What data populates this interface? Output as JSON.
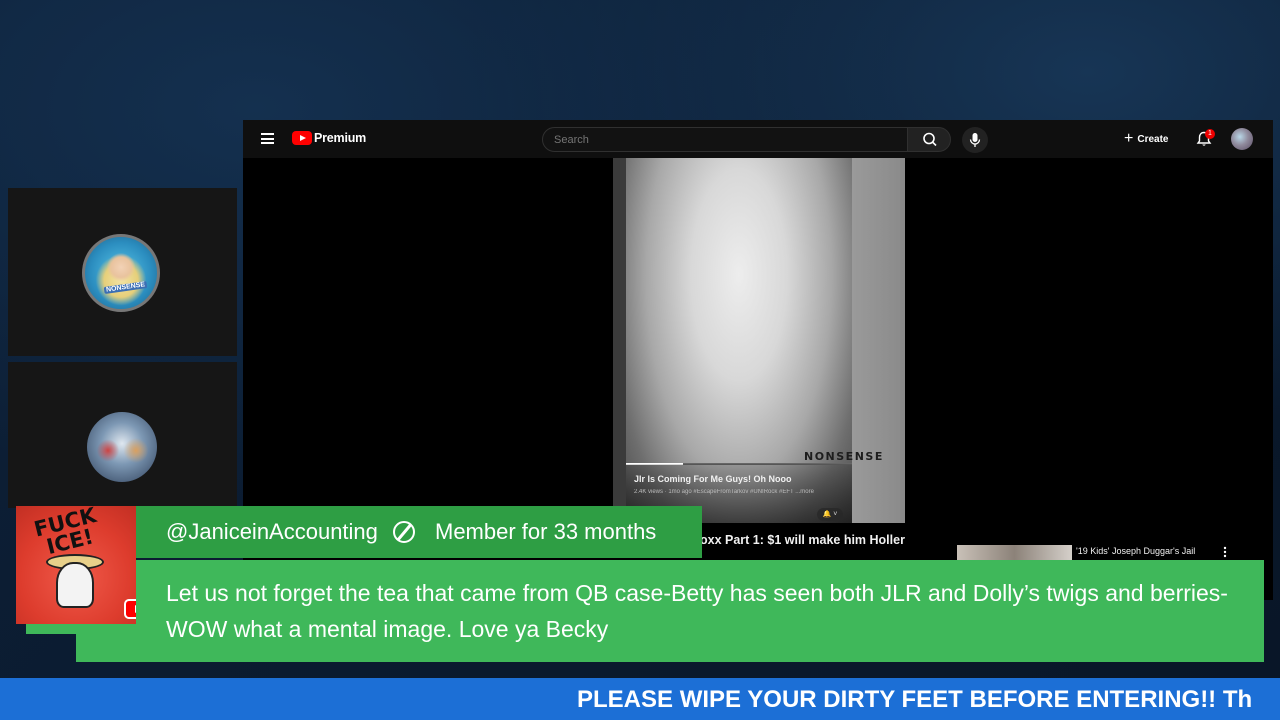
{
  "youtube": {
    "brand": "Premium",
    "search_placeholder": "Search",
    "create_label": "Create",
    "notification_count": "1",
    "short": {
      "title": "Jlr Is Coming For Me Guys! Oh Nooo",
      "meta": "2.4K views · 1mo ago #EscapeFromTarkov #UNIRock #EFT ...more",
      "watermark": "NONSENSE",
      "progress": 0.25
    },
    "video_title_peek": "oxx Part 1: $1 will make him Holler",
    "recommended_title": "'19 Kids' Joseph Duggar's Jail"
  },
  "cams": [
    {
      "badge": "NONSENSE"
    },
    {
      "badge": ""
    }
  ],
  "chat": {
    "avatar_text": "FUCK ICE!",
    "username": "@JaniceinAccounting",
    "membership": "Member for 33 months",
    "message": "Let us not forget the tea that came from QB case-Betty has seen both JLR and Dolly’s twigs and berries-WOW what a mental image. Love ya Becky"
  },
  "ticker": {
    "text": "PLEASE WIPE YOUR DIRTY FEET BEFORE ENTERING!! Th"
  },
  "colors": {
    "chat_header": "#2e9e44",
    "chat_body": "#3fb85a",
    "ticker": "#1c6fd6",
    "youtube_red": "#ff0000"
  },
  "icons": [
    "menu-icon",
    "search-icon",
    "mic-icon",
    "plus-icon",
    "bell-icon",
    "more-vertical-icon",
    "member-badge-icon",
    "youtube-logo-icon"
  ]
}
